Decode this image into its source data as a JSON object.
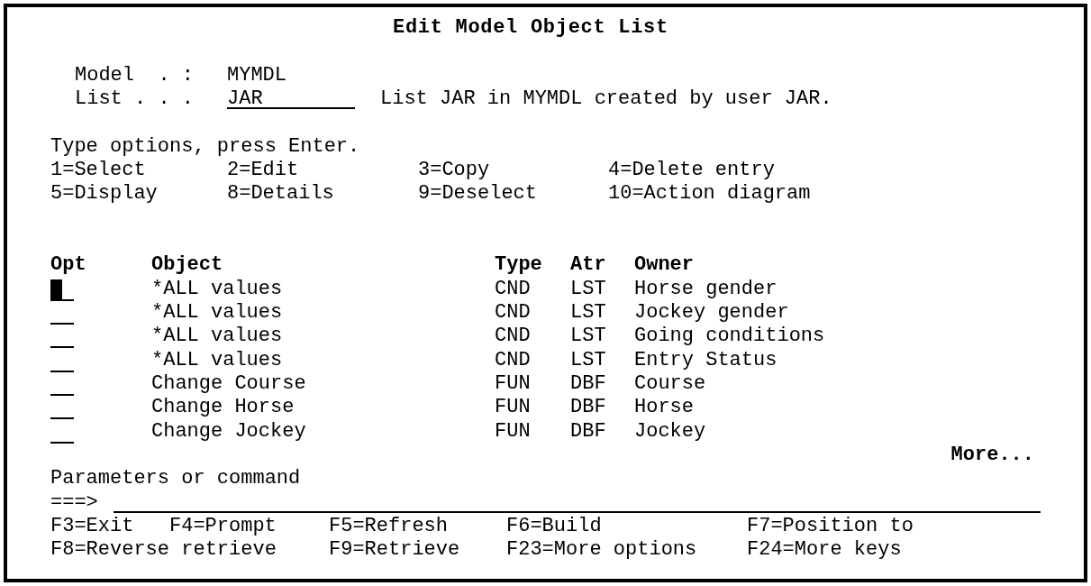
{
  "screen": {
    "title": "Edit Model Object List"
  },
  "header_fields": [
    {
      "label": "Model  . :",
      "kind": "output",
      "value": "MYMDL"
    },
    {
      "label": "List . . .",
      "kind": "input",
      "value": "JAR",
      "description": "List JAR in MYMDL created by user JAR."
    }
  ],
  "instructions": "Type options, press Enter.",
  "options": [
    "1=Select",
    "2=Edit",
    "3=Copy",
    "4=Delete entry",
    "5=Display",
    "8=Details",
    "9=Deselect",
    "10=Action diagram"
  ],
  "list": {
    "columns": [
      "Opt",
      "Object",
      "Type",
      "Atr",
      "Owner"
    ],
    "rows": [
      {
        "focused": true,
        "object": "*ALL values",
        "type": "CND",
        "atr": "LST",
        "owner": "Horse gender"
      },
      {
        "focused": false,
        "object": "*ALL values",
        "type": "CND",
        "atr": "LST",
        "owner": "Jockey gender"
      },
      {
        "focused": false,
        "object": "*ALL values",
        "type": "CND",
        "atr": "LST",
        "owner": "Going conditions"
      },
      {
        "focused": false,
        "object": "*ALL values",
        "type": "CND",
        "atr": "LST",
        "owner": "Entry Status"
      },
      {
        "focused": false,
        "object": "Change Course",
        "type": "FUN",
        "atr": "DBF",
        "owner": "Course"
      },
      {
        "focused": false,
        "object": "Change Horse",
        "type": "FUN",
        "atr": "DBF",
        "owner": "Horse"
      },
      {
        "focused": false,
        "object": "Change Jockey",
        "type": "FUN",
        "atr": "DBF",
        "owner": "Jockey"
      }
    ],
    "more": "More..."
  },
  "command": {
    "label": "Parameters or command",
    "prompt": "===>"
  },
  "function_keys": [
    [
      "F3=Exit",
      "F4=Prompt",
      "F5=Refresh",
      "F6=Build",
      "F7=Position to"
    ],
    [
      "F8=Reverse retrieve",
      "F9=Retrieve",
      "F23=More options",
      "F24=More keys"
    ]
  ]
}
